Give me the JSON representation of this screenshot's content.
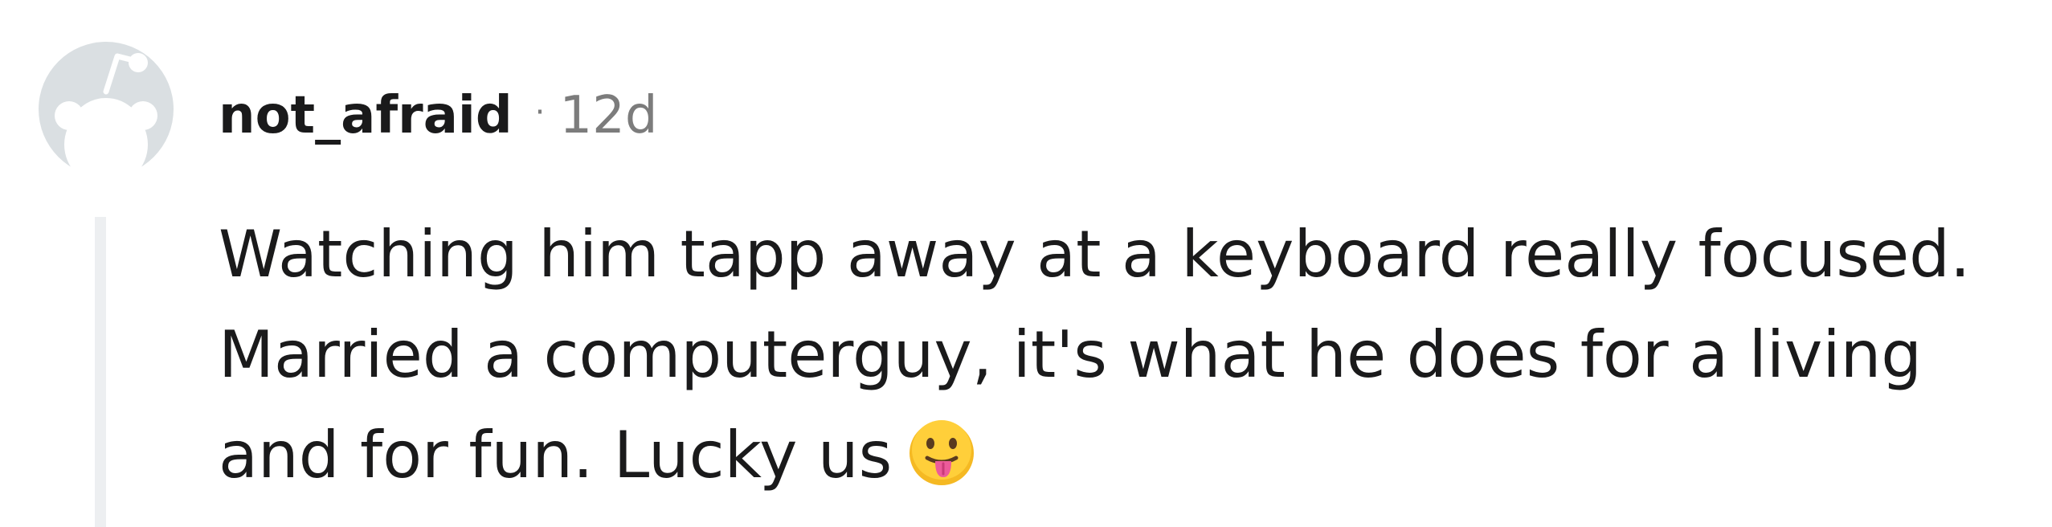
{
  "comment": {
    "avatar_icon": "reddit-snoo-avatar-icon",
    "username": "not_afraid",
    "separator": "·",
    "age": "12d",
    "body_lines": [
      "Watching him tapp away at a keyboard really focused.",
      "Married a computerguy, it's what he does for a living",
      "and for fun. Lucky us"
    ],
    "emoji_icon": "face-with-tongue-emoji-icon",
    "colors": {
      "avatar_bg": "#dadfe2",
      "thread_line": "#edeff1",
      "text": "#1a1a1b",
      "meta": "#7c7c7c"
    }
  }
}
